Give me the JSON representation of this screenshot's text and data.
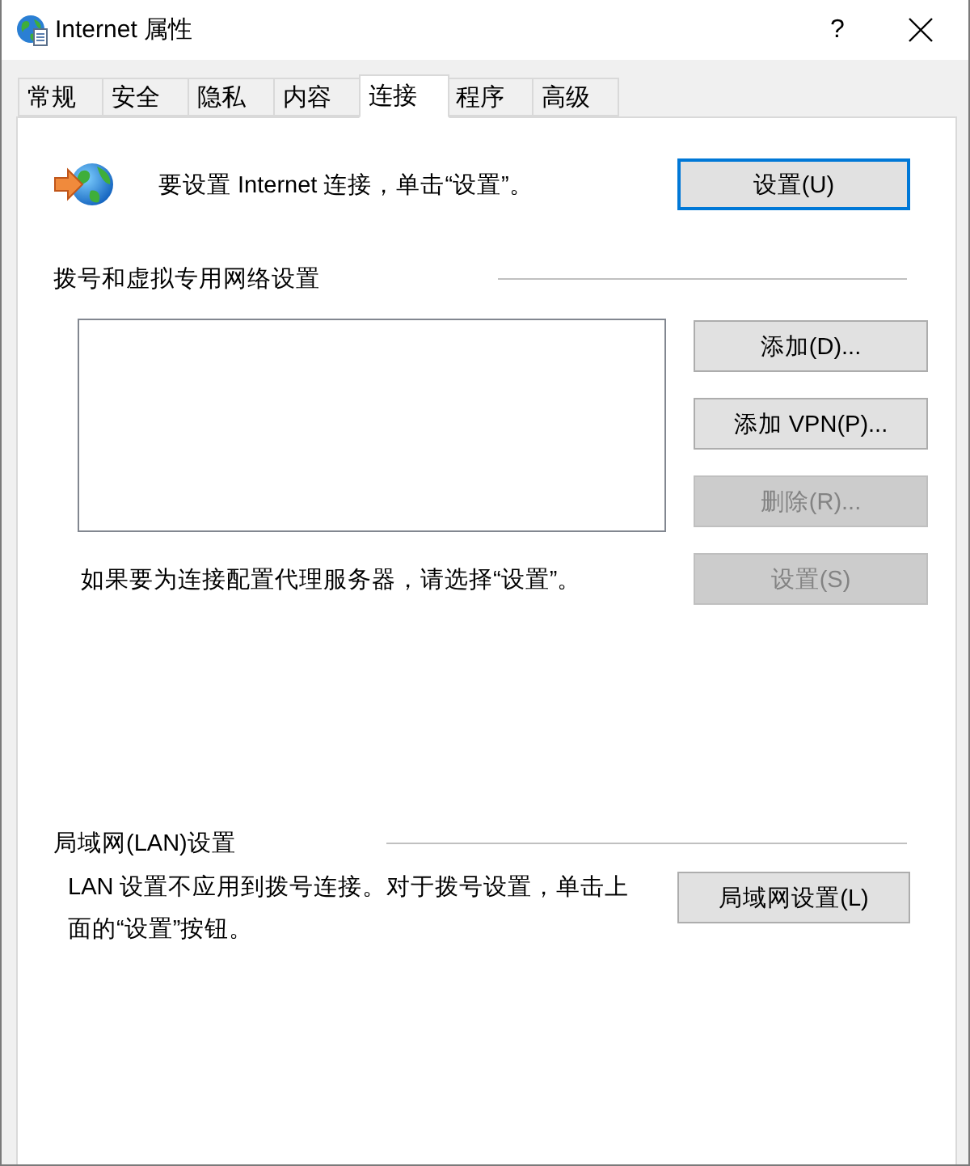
{
  "window": {
    "title": "Internet 属性",
    "help": "?"
  },
  "tabs": [
    {
      "label": "常规",
      "selected": false
    },
    {
      "label": "安全",
      "selected": false
    },
    {
      "label": "隐私",
      "selected": false
    },
    {
      "label": "内容",
      "selected": false
    },
    {
      "label": "连接",
      "selected": true
    },
    {
      "label": "程序",
      "selected": false
    },
    {
      "label": "高级",
      "selected": false
    }
  ],
  "setup": {
    "text": "要设置 Internet 连接，单击“设置”。",
    "button": {
      "label": "设置(U)",
      "default": true
    }
  },
  "dialup": {
    "heading": "拨号和虚拟专用网络设置",
    "buttons": [
      {
        "label": "添加(D)...",
        "disabled": false
      },
      {
        "label": "添加 VPN(P)...",
        "disabled": false
      },
      {
        "label": "删除(R)...",
        "disabled": true
      }
    ],
    "proxy_text": "如果要为连接配置代理服务器，请选择“设置”。",
    "proxy_button": {
      "label": "设置(S)",
      "disabled": true
    }
  },
  "lan": {
    "heading": "局域网(LAN)设置",
    "text": "LAN 设置不应用到拨号连接。对于拨号设置，单击上面的“设置”按钮。",
    "button": {
      "label": "局域网设置(L)",
      "disabled": false
    }
  }
}
